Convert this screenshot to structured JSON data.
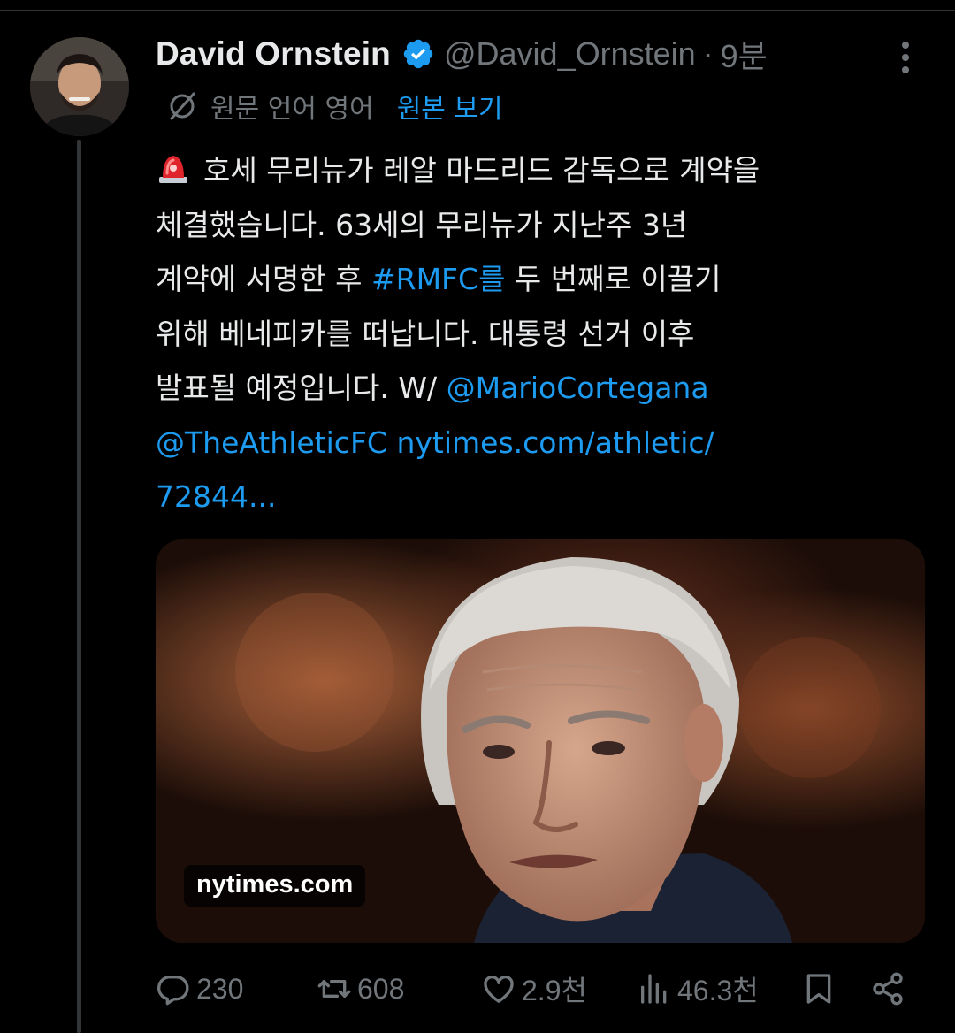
{
  "tweet": {
    "author_name": "David Ornstein",
    "handle": "@David_Ornstein",
    "separator": "·",
    "time": "9분",
    "translation": {
      "label": "원문 언어 영어",
      "show_original": "원본 보기"
    },
    "text_lines": [
      {
        "text": "호세 무리뉴가 레알 마드리드 감독으로 계약을"
      },
      {
        "text": "체결했습니다. 63세의 무리뉴가 지난주 3년"
      },
      {
        "pre": "계약에 서명한 후 ",
        "link": "#RMFC를",
        "post": " 두 번째로 이끌기"
      },
      {
        "text": "위해 베네피카를 떠납니다. 대통령 선거 이후"
      },
      {
        "pre": "발표될 예정입니다. W/ ",
        "link": "@MarioCortegana"
      },
      {
        "link": "@TheAthleticFC",
        "post_link": " nytimes.com/athletic/"
      },
      {
        "link": "72844..."
      }
    ],
    "media": {
      "domain": "nytimes.com"
    },
    "stats": {
      "replies": "230",
      "reposts": "608",
      "likes": "2.9천",
      "views": "46.3천"
    },
    "icons": {
      "verified": "verified-badge-icon",
      "more": "more-vertical-icon",
      "translate": "globe-off-icon",
      "emoji": "police-siren-emoji",
      "reply": "reply-icon",
      "repost": "repost-icon",
      "like": "heart-icon",
      "views": "views-icon",
      "bookmark": "bookmark-icon",
      "share": "share-icon"
    },
    "colors": {
      "background": "#000000",
      "text": "#e7e9ea",
      "secondary": "#71767b",
      "link": "#1d9bf0",
      "verified": "#1d9bf0"
    }
  }
}
